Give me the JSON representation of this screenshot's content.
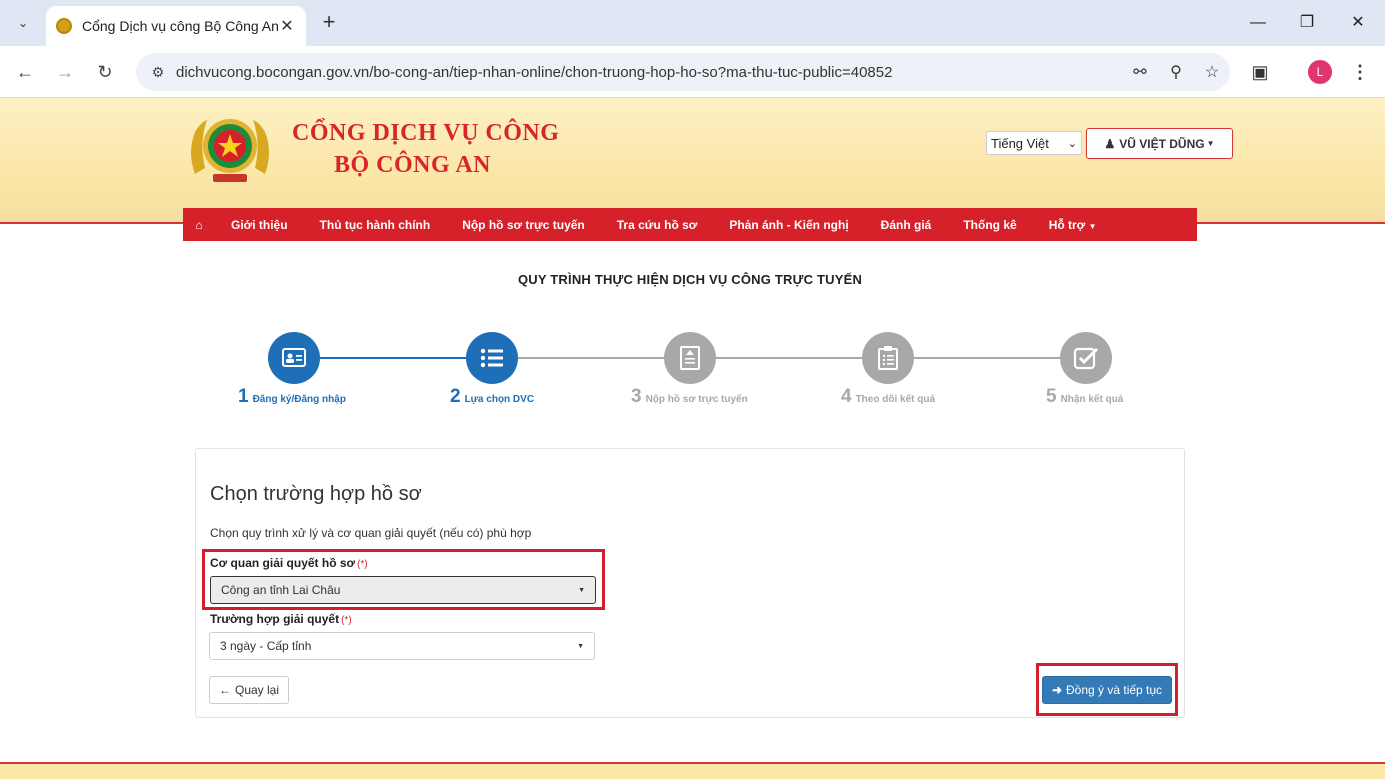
{
  "browser": {
    "tab_title": "Cổng Dịch vụ công Bộ Công An",
    "url": "dichvucong.bocongan.gov.vn/bo-cong-an/tiep-nhan-online/chon-truong-hop-ho-so?ma-thu-tuc-public=40852",
    "profile_initial": "L"
  },
  "header": {
    "brand_line1": "CỔNG DỊCH VỤ CÔNG",
    "brand_line2": "BỘ CÔNG AN",
    "language": "Tiếng Việt",
    "user_name": "VŨ VIỆT DŨNG"
  },
  "menu": {
    "items": [
      "Giới thiệu",
      "Thủ tục hành chính",
      "Nộp hồ sơ trực tuyến",
      "Tra cứu hồ sơ",
      "Phản ánh - Kiến nghị",
      "Đánh giá",
      "Thống kê",
      "Hỗ trợ"
    ]
  },
  "process": {
    "title": "QUY TRÌNH THỰC HIỆN DỊCH VỤ CÔNG TRỰC TUYẾN",
    "steps": [
      {
        "num": "1",
        "label": "Đăng ký/Đăng nhập",
        "state": "active"
      },
      {
        "num": "2",
        "label": "Lựa chọn DVC",
        "state": "active"
      },
      {
        "num": "3",
        "label": "Nộp hồ sơ trực tuyến",
        "state": "inactive"
      },
      {
        "num": "4",
        "label": "Theo dõi kết quả",
        "state": "inactive"
      },
      {
        "num": "5",
        "label": "Nhận kết quả",
        "state": "inactive"
      }
    ]
  },
  "form": {
    "title": "Chọn trường hợp hồ sơ",
    "subtitle": "Chọn quy trình xử lý và cơ quan giải quyết (nếu có) phù hợp",
    "agency_label": "Cơ quan giải quyết hồ sơ",
    "agency_value": "Công an tỉnh Lai Châu",
    "case_label": "Trường hợp giải quyết",
    "case_value": "3 ngày - Cấp tỉnh",
    "required_mark": "(*)",
    "back_label": "Quay lại",
    "next_label": "Đồng ý và tiếp tục"
  },
  "colors": {
    "brand_red": "#d6202a",
    "step_active": "#1f6fb8",
    "step_inactive": "#a8a8a8",
    "primary_button": "#337ab7",
    "highlight": "#d21f2e"
  }
}
